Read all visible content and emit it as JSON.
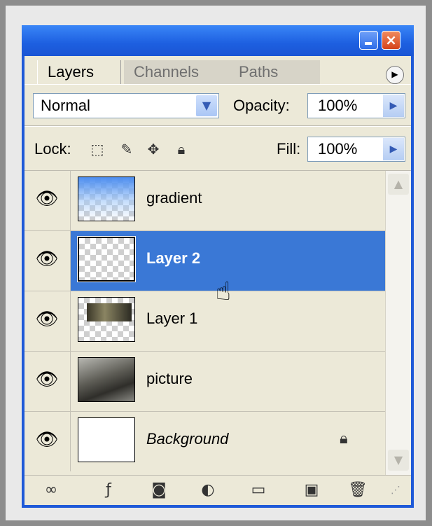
{
  "tabs": [
    {
      "label": "Layers",
      "active": true
    },
    {
      "label": "Channels",
      "active": false
    },
    {
      "label": "Paths",
      "active": false
    }
  ],
  "blend_mode": "Normal",
  "opacity": {
    "label": "Opacity:",
    "value": "100%"
  },
  "lock": {
    "label": "Lock:"
  },
  "fill": {
    "label": "Fill:",
    "value": "100%"
  },
  "layers": [
    {
      "name": "gradient",
      "visible": true,
      "selected": false
    },
    {
      "name": "Layer 2",
      "visible": true,
      "selected": true
    },
    {
      "name": "Layer 1",
      "visible": true,
      "selected": false
    },
    {
      "name": "picture",
      "visible": true,
      "selected": false
    },
    {
      "name": "Background",
      "visible": true,
      "selected": false,
      "locked": true
    }
  ],
  "colors": {
    "titlebar": "#1f5ad8",
    "selection": "#3a78d6",
    "panel": "#ece9d8"
  }
}
